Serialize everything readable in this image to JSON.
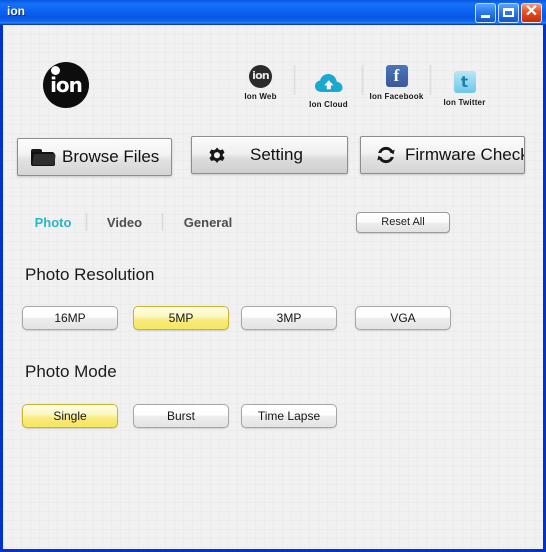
{
  "window": {
    "title": "ion",
    "controls": {
      "minimize": "minimize-button",
      "maximize": "maximize-button",
      "close": "close-button"
    },
    "accent_titlebar": "#0b62f2",
    "client_background": "#f1f1f1"
  },
  "header": {
    "brand_logo_text": "ion",
    "nav": [
      {
        "label": "Ion Web",
        "icon": "ion-web-icon"
      },
      {
        "label": "Ion Cloud",
        "icon": "ion-cloud-icon"
      },
      {
        "label": "Ion Facebook",
        "icon": "facebook-icon"
      },
      {
        "label": "Ion Twitter",
        "icon": "twitter-icon"
      }
    ]
  },
  "toolbar": {
    "browse_label": "Browse Files",
    "browse_icon": "folder-icon",
    "setting_label": "Setting",
    "setting_icon": "gear-icon",
    "firmware_label": "Firmware Check",
    "firmware_icon": "refresh-icon"
  },
  "tabs": {
    "items": [
      {
        "label": "Photo",
        "active": true
      },
      {
        "label": "Video",
        "active": false
      },
      {
        "label": "General",
        "active": false
      }
    ],
    "active_color": "#29b6c8",
    "inactive_color": "#4d4d4d",
    "reset_label": "Reset All"
  },
  "sections": [
    {
      "title": "Photo Resolution",
      "options": [
        {
          "label": "16MP",
          "selected": false
        },
        {
          "label": "5MP",
          "selected": true
        },
        {
          "label": "3MP",
          "selected": false
        },
        {
          "label": "VGA",
          "selected": false
        }
      ]
    },
    {
      "title": "Photo Mode",
      "options": [
        {
          "label": "Single",
          "selected": true
        },
        {
          "label": "Burst",
          "selected": false
        },
        {
          "label": "Time Lapse",
          "selected": false
        }
      ]
    }
  ],
  "selection_color": "#f6e75f"
}
